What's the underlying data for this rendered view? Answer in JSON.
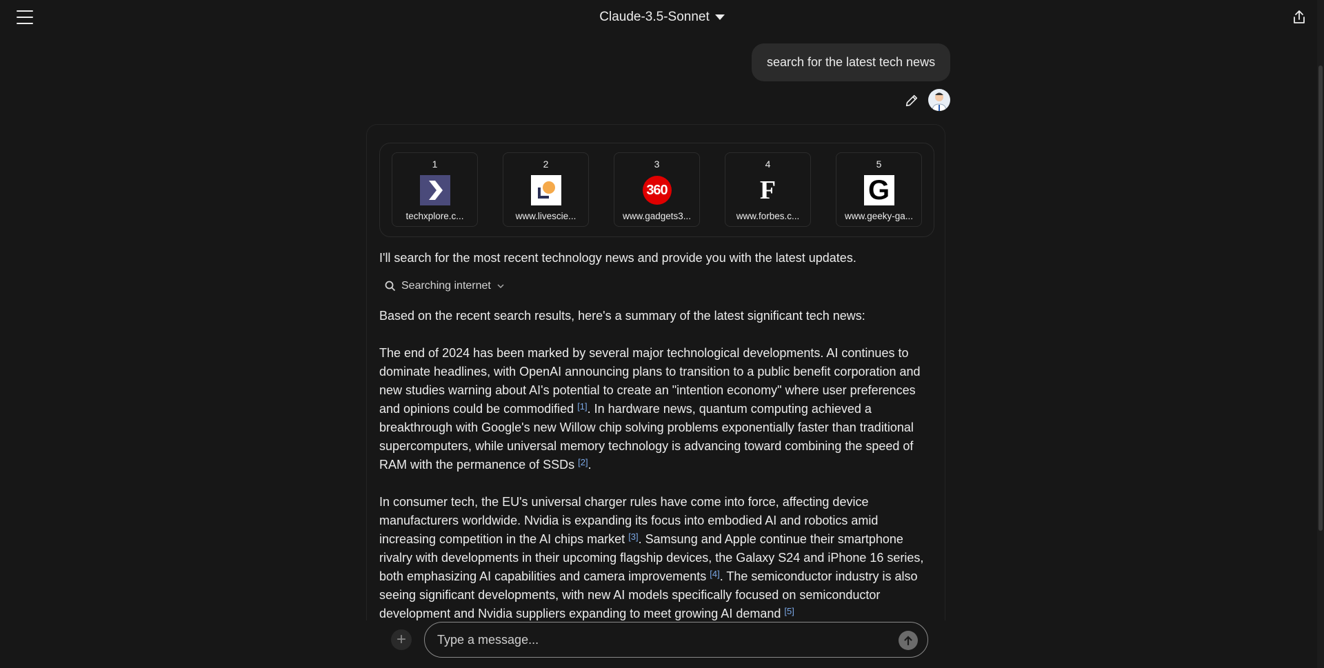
{
  "header": {
    "model": "Claude-3.5-Sonnet"
  },
  "user_message": "search for the latest tech news",
  "sources": [
    {
      "num": "1",
      "url": "techxplore.c...",
      "logo": "techxplore-chevron-logo"
    },
    {
      "num": "2",
      "url": "www.livescie...",
      "logo": "livescience-logo"
    },
    {
      "num": "3",
      "url": "www.gadgets3...",
      "logo": "360",
      "logo_color": "#e00000"
    },
    {
      "num": "4",
      "url": "www.forbes.c...",
      "logo": "F"
    },
    {
      "num": "5",
      "url": "www.geeky-ga...",
      "logo": "G"
    }
  ],
  "intro": "I'll search for the most recent technology news and provide you with the latest updates.",
  "searching_label": "Searching internet",
  "summary_intro": "Based on the recent search results, here's a summary of the latest significant tech news:",
  "para1": {
    "a": "The end of 2024 has been marked by several major technological developments. AI continues to dominate headlines, with OpenAI announcing plans to transition to a public benefit corporation and new studies warning about AI's potential to create an \"intention economy\" where user preferences and opinions could be commodified ",
    "c1": "[1]",
    "b": ". In hardware news, quantum computing achieved a breakthrough with Google's new Willow chip solving problems exponentially faster than traditional supercomputers, while universal memory technology is advancing toward combining the speed of RAM with the permanence of SSDs ",
    "c2": "[2]",
    "d": "."
  },
  "para2": {
    "a": "In consumer tech, the EU's universal charger rules have come into force, affecting device manufacturers worldwide. Nvidia is expanding its focus into embodied AI and robotics amid increasing competition in the AI chips market ",
    "c3": "[3]",
    "b": ". Samsung and Apple continue their smartphone rivalry with developments in their upcoming flagship devices, the Galaxy S24 and iPhone 16 series, both emphasizing AI capabilities and camera improvements ",
    "c4": "[4]",
    "d": ". The semiconductor industry is also seeing significant developments, with new AI models specifically focused on semiconductor development and Nvidia suppliers expanding to meet growing AI demand ",
    "c5": "[5]"
  },
  "input": {
    "placeholder": "Type a message..."
  },
  "colors": {
    "background": "#171717",
    "citation": "#7aa7e6",
    "bubble": "#2b2b2b"
  }
}
